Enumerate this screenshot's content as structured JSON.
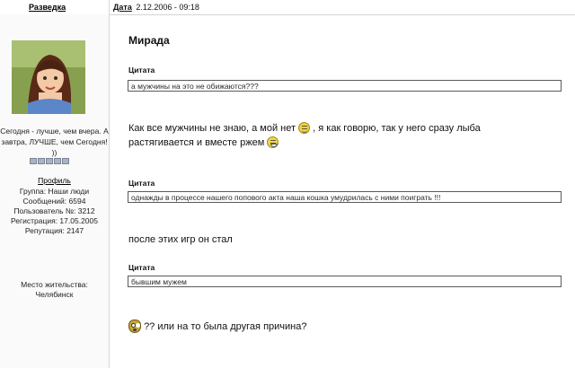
{
  "header": {
    "author": "Разведка",
    "date_label": "Дата",
    "date_value": "2.12.2006 - 09:18"
  },
  "sidebar": {
    "status": "Сегодня - лучше, чем вчера. А завтра, ЛУЧШЕ, чем Сегодня! ))",
    "profile_link": "Профиль",
    "group": "Группа: Наши люди",
    "messages": "Сообщений: 6594",
    "user_no": "Пользователь №: 3212",
    "registered": "Регистрация: 17.05.2005",
    "reputation": "Репутация: 2147",
    "location_label": "Место жительства:",
    "location_value": "Челябинск"
  },
  "post": {
    "username": "Мирада",
    "quote_label": "Цитата",
    "quote1": "а мужчины на это не обижаются???",
    "para1_a": "Как все мужчины не знаю, а мой нет",
    "para1_b": ", я как говорю, так у него сразу лыба",
    "para1_c": "растягивается и вместе ржем",
    "quote2": "однажды в процессе нашего попового акта наша кошка умудрилась с ними поиграть !!!",
    "para2": "после этих игр он стал",
    "quote3": "бывшим мужем",
    "para3": "?? или на то была другая причина?"
  },
  "icons": [
    "smile-icon",
    "grin-icon",
    "owl-icon"
  ]
}
